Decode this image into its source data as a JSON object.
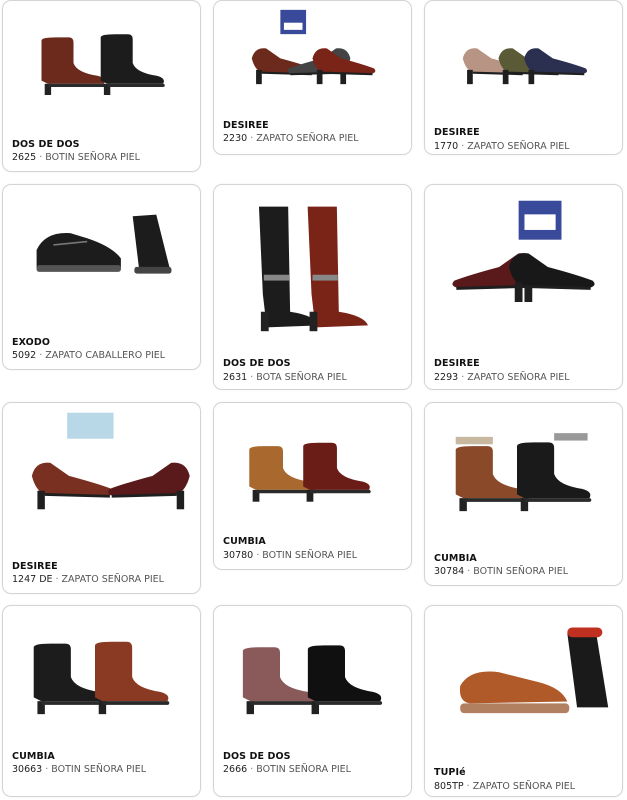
{
  "products": [
    {
      "brand": "DOS DE DOS",
      "ref": "2625",
      "desc": "BOTIN SEÑORA PIEL",
      "image": "brown and black ankle boots with buckle"
    },
    {
      "brand": "DESIREE",
      "ref": "2230",
      "desc": "ZAPATO SEÑORA PIEL",
      "image": "brown, grey and red pumps",
      "badge": "DESIREE"
    },
    {
      "brand": "DESIREE",
      "ref": "1770",
      "desc": "ZAPATO SEÑORA PIEL",
      "image": "beige, olive and navy suede pumps"
    },
    {
      "brand": "EXODO",
      "ref": "5092",
      "desc": "ZAPATO CABALLERO PIEL",
      "image": "black men's sneakers"
    },
    {
      "brand": "DOS DE DOS",
      "ref": "2631",
      "desc": "BOTA SEÑORA PIEL",
      "image": "black and brown knee-high boots"
    },
    {
      "brand": "DESIREE",
      "ref": "2293",
      "desc": "ZAPATO SEÑORA PIEL",
      "image": "burgundy and black patent pumps",
      "badge": "DESIREE"
    },
    {
      "brand": "DESIREE",
      "ref": "1247 DE",
      "desc": "ZAPATO SEÑORA PIEL",
      "image": "brown pumps with patent toe cap"
    },
    {
      "brand": "CUMBIA",
      "ref": "30780",
      "desc": "BOTIN SEÑORA PIEL",
      "image": "tan and burgundy ankle boots"
    },
    {
      "brand": "CUMBIA",
      "ref": "30784",
      "desc": "BOTIN SEÑORA PIEL",
      "image": "brown and black fur-lined boots"
    },
    {
      "brand": "CUMBIA",
      "ref": "30663",
      "desc": "BOTIN SEÑORA PIEL",
      "image": "black and brown cuffed ankle boots"
    },
    {
      "brand": "DOS DE DOS",
      "ref": "2666",
      "desc": "BOTIN SEÑORA PIEL",
      "image": "mauve and black suede ankle boots"
    },
    {
      "brand": "TUPIé",
      "ref": "805TP",
      "desc": "ZAPATO SEÑORA PIEL",
      "image": "tan and black mary jane shoes"
    }
  ],
  "colors": {
    "card_border": "#d4d4d4",
    "brown": "#6b2a1c",
    "black": "#1c1c1c",
    "tan": "#a65a2e",
    "burgundy": "#5a1a1c",
    "navy": "#2b3050",
    "badge_blue": "#3a4a9a"
  }
}
